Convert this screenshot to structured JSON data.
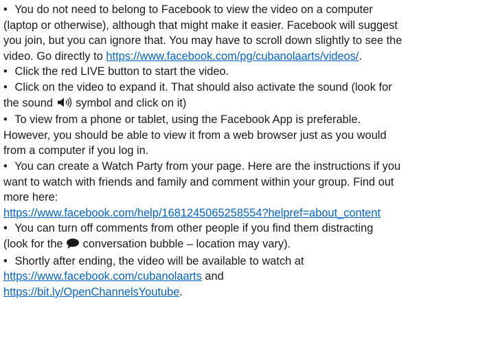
{
  "bullet_char": "•",
  "link_color": "#0563c1",
  "items": [
    {
      "l1": " You do not need to belong to Facebook to view the video on a computer",
      "l2": "(laptop or otherwise), although that might make it easier. Facebook will suggest",
      "l3": "you join, but you can ignore that. You may have to scroll down slightly to see the",
      "l4_prefix": "video. Go directly to ",
      "l4_link": "https://www.facebook.com/pg/cubanolaarts/videos/",
      "l4_suffix": "."
    },
    {
      "l1": " Click the red LIVE button to start the video."
    },
    {
      "l1": " Click on the video to expand it. That should also activate the sound (look for",
      "l2_prefix": "the sound ",
      "l2_icon": "speaker-icon",
      "l2_suffix": " symbol and click on it)"
    },
    {
      "l1": " To view from a phone or tablet, using the Facebook App is preferable.",
      "l2": "However, you should be able to view it from a web browser just as you would",
      "l3": "from a computer if you log in."
    },
    {
      "l1": " You can create a Watch Party from your page. Here are the instructions if you",
      "l2": "want to watch with friends and family and comment within your group. Find out",
      "l3": "more here:",
      "l4_link": "https://www.facebook.com/help/1681245065258554?helpref=about_content"
    },
    {
      "l1": " You can turn off comments from other people if you find them distracting",
      "l2_prefix": "(look for the ",
      "l2_icon": "speech-bubble-icon",
      "l2_suffix": " conversation bubble – location may vary)."
    },
    {
      "l1": " Shortly after ending, the video will be available to watch at",
      "l2_link": "https://www.facebook.com/cubanolaarts",
      "l2_suffix": " and",
      "l3_link": "https://bit.ly/OpenChannelsYoutube",
      "l3_suffix": "."
    }
  ]
}
